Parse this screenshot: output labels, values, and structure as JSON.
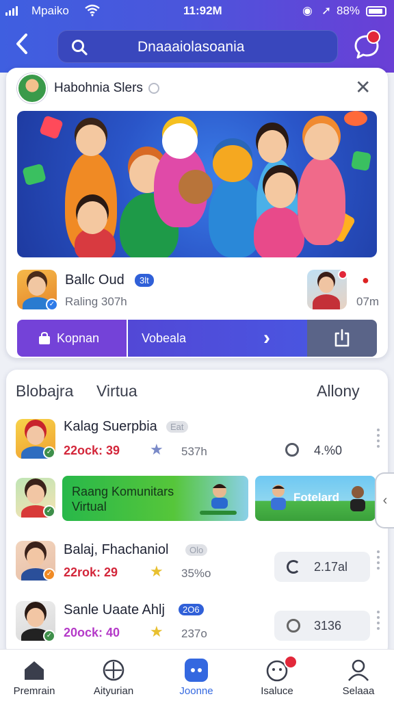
{
  "status_bar": {
    "carrier": "Mpaiko",
    "time": "11:92M",
    "battery": "88%"
  },
  "header": {
    "search_text": "Dnaaaiolasoania"
  },
  "feature": {
    "title": "Habohnia Slers",
    "profile_name": "Ballc Oud",
    "profile_badge": "3lt",
    "rating_text": "Raling 307h",
    "viewer_count": "07m",
    "action_primary": "Kopnan",
    "action_secondary": "Vobeala"
  },
  "list": {
    "headers": [
      "Blobajra",
      "Virtua",
      "Allony"
    ],
    "rows": [
      {
        "name": "Kalag Suerpbia",
        "tag": "Eat",
        "meta": "22ock: 39",
        "sub": "537h",
        "stat": "4.%0",
        "meta_color": "#d3263a"
      },
      {
        "name": "Balaj, Fhachaniol",
        "tag": "Olo",
        "meta": "22rok: 29",
        "sub": "35%o",
        "stat": "2.17al",
        "meta_color": "#d3263a"
      },
      {
        "name": "Sanle Uaate Ahlj",
        "tag": "2O6",
        "meta": "20ock: 40",
        "sub": "237o",
        "stat": "3136",
        "meta_color": "#b43ac8"
      }
    ],
    "banner_primary": "Raang Komunitars Virtual",
    "banner_secondary": "Fotelard"
  },
  "bottom_nav": [
    {
      "label": "Premrain",
      "icon": "home-icon"
    },
    {
      "label": "Aityurian",
      "icon": "compass-icon"
    },
    {
      "label": "Joonne",
      "icon": "chat-bubble-icon",
      "active": true
    },
    {
      "label": "Isaluce",
      "icon": "notification-face-icon",
      "badge": true
    },
    {
      "label": "Selaaa",
      "icon": "profile-icon"
    }
  ],
  "colors": {
    "header_start": "#3f5fe0",
    "header_end": "#6a3fd6",
    "accent": "#3468e0",
    "badge": "#e2283a"
  }
}
